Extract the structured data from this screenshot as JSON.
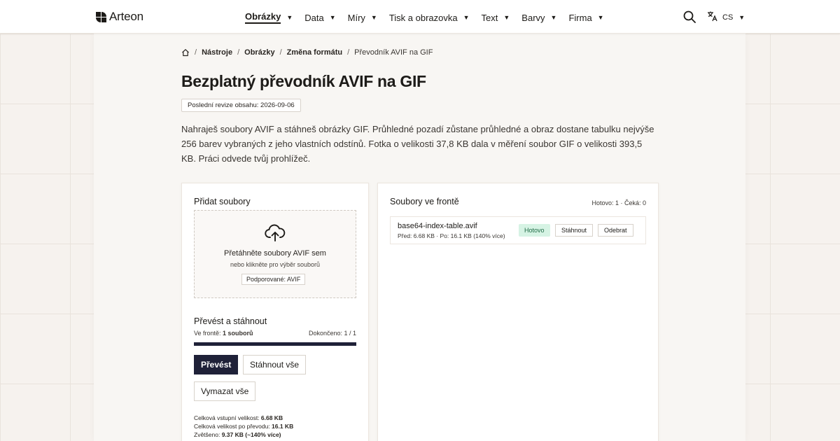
{
  "brand": {
    "name": "Arteon"
  },
  "nav": {
    "items": [
      {
        "label": "Obrázky",
        "active": true
      },
      {
        "label": "Data"
      },
      {
        "label": "Míry"
      },
      {
        "label": "Tisk a obrazovka"
      },
      {
        "label": "Text"
      },
      {
        "label": "Barvy"
      },
      {
        "label": "Firma"
      }
    ],
    "language": "CS"
  },
  "breadcrumb": {
    "items": [
      "Nástroje",
      "Obrázky",
      "Změna formátu"
    ],
    "current": "Převodník AVIF na GIF"
  },
  "page": {
    "title": "Bezplatný převodník AVIF na GIF",
    "revision": "Poslední revize obsahu: 2026-09-06",
    "intro": "Nahraješ soubory AVIF a stáhneš obrázky GIF. Průhledné pozadí zůstane průhledné a obraz dostane tabulku nejvýše 256 barev vybraných z jeho vlastních odstínů. Fotka o velikosti 37,8 KB dala v měření soubor GIF o velikosti 393,5 KB. Práci odvede tvůj prohlížeč."
  },
  "upload": {
    "title": "Přidat soubory",
    "drop_main": "Přetáhněte soubory AVIF sem",
    "drop_sub": "nebo klikněte pro výběr souborů",
    "supported": "Podporované: AVIF"
  },
  "convert": {
    "title": "Převést a stáhnout",
    "queue_label": "Ve frontě: ",
    "queue_value": "1 souborů",
    "done_label": "Dokončeno: 1 / 1",
    "progress": 1.0,
    "convert_button": "Převést",
    "download_all_button": "Stáhnout vše",
    "clear_all_button": "Vymazat vše"
  },
  "stats": {
    "input_label": "Celková vstupní velikost: ",
    "input_value": "6.68 KB",
    "output_label": "Celková velikost po převodu: ",
    "output_value": "16.1 KB",
    "growth_label": "Zvětšeno: ",
    "growth_value": "9.37 KB (~140% více)"
  },
  "queue": {
    "title": "Soubory ve frontě",
    "summary": "Hotovo: 1 · Čeká: 0",
    "files": [
      {
        "name": "base64-index-table.avif",
        "meta": "Před: 6.68 KB · Po: 16.1 KB (140% více)",
        "status": "Hotovo",
        "download": "Stáhnout",
        "remove": "Odebrat"
      }
    ]
  },
  "colors": {
    "primary": "#1f2138",
    "success_bg": "#d6f3e4",
    "success_text": "#1e6a45",
    "page_bg": "#f6f2ee"
  }
}
